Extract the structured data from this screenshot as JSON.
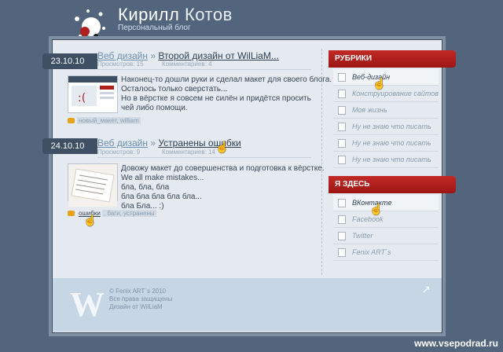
{
  "header": {
    "title_first": "Кирилл",
    "title_last": "Котов",
    "subtitle": "Персональный блог"
  },
  "posts": [
    {
      "date": "23.10.10",
      "category": "Веб дизайн",
      "separator": "»",
      "title": "Второй дизайн от WilLiaM...",
      "views": "Просмотров: 15",
      "comments": "Комментариев: 4",
      "excerpt": [
        "Наконец-то дошли руки и сделал макет для своего блога.",
        "Осталось только сверстать...",
        "Но в вёрстке я совсем не силён и придётся просить",
        "чей либо помощи."
      ],
      "tags": [
        "новый_макет, william"
      ]
    },
    {
      "date": "24.10.10",
      "category": "Веб дизайн",
      "separator": "»",
      "title": "Устранены ошибки",
      "views": "Просмотров: 9",
      "comments": "Комментариев: 14",
      "excerpt": [
        "Довожу макет до совершенства и подготовка к вёрстке.",
        "We all make mistakes...",
        "бла, бла, бла",
        "бла бла бла бла бла...",
        "бла Бла... :)"
      ],
      "tags": [
        "ошибки",
        ", баги, устранены"
      ]
    }
  ],
  "sidebar": {
    "rubrics_title": "РУБРИКИ",
    "rubrics": [
      "Веб-дизайн",
      "Конструирование сайтов",
      "Моя жизнь",
      "Ну не знаю что писать",
      "Ну не знаю что писать",
      "Ну не знаю что писать"
    ],
    "here_title": "Я ЗДЕСЬ",
    "here": [
      "ВКонтакте",
      "Facebook",
      "Twitter",
      "Fenix ART`s"
    ]
  },
  "footer": {
    "logo": "W",
    "lines": [
      "© Fenix ART`s 2010",
      "Все права защищены",
      "Дизайн от WilLiaM"
    ]
  },
  "watermark": "www.vsepodrad.ru",
  "colors": {
    "background": "#53657c",
    "ribbon": "#b11f1d",
    "date_tab": "#3f5064"
  }
}
